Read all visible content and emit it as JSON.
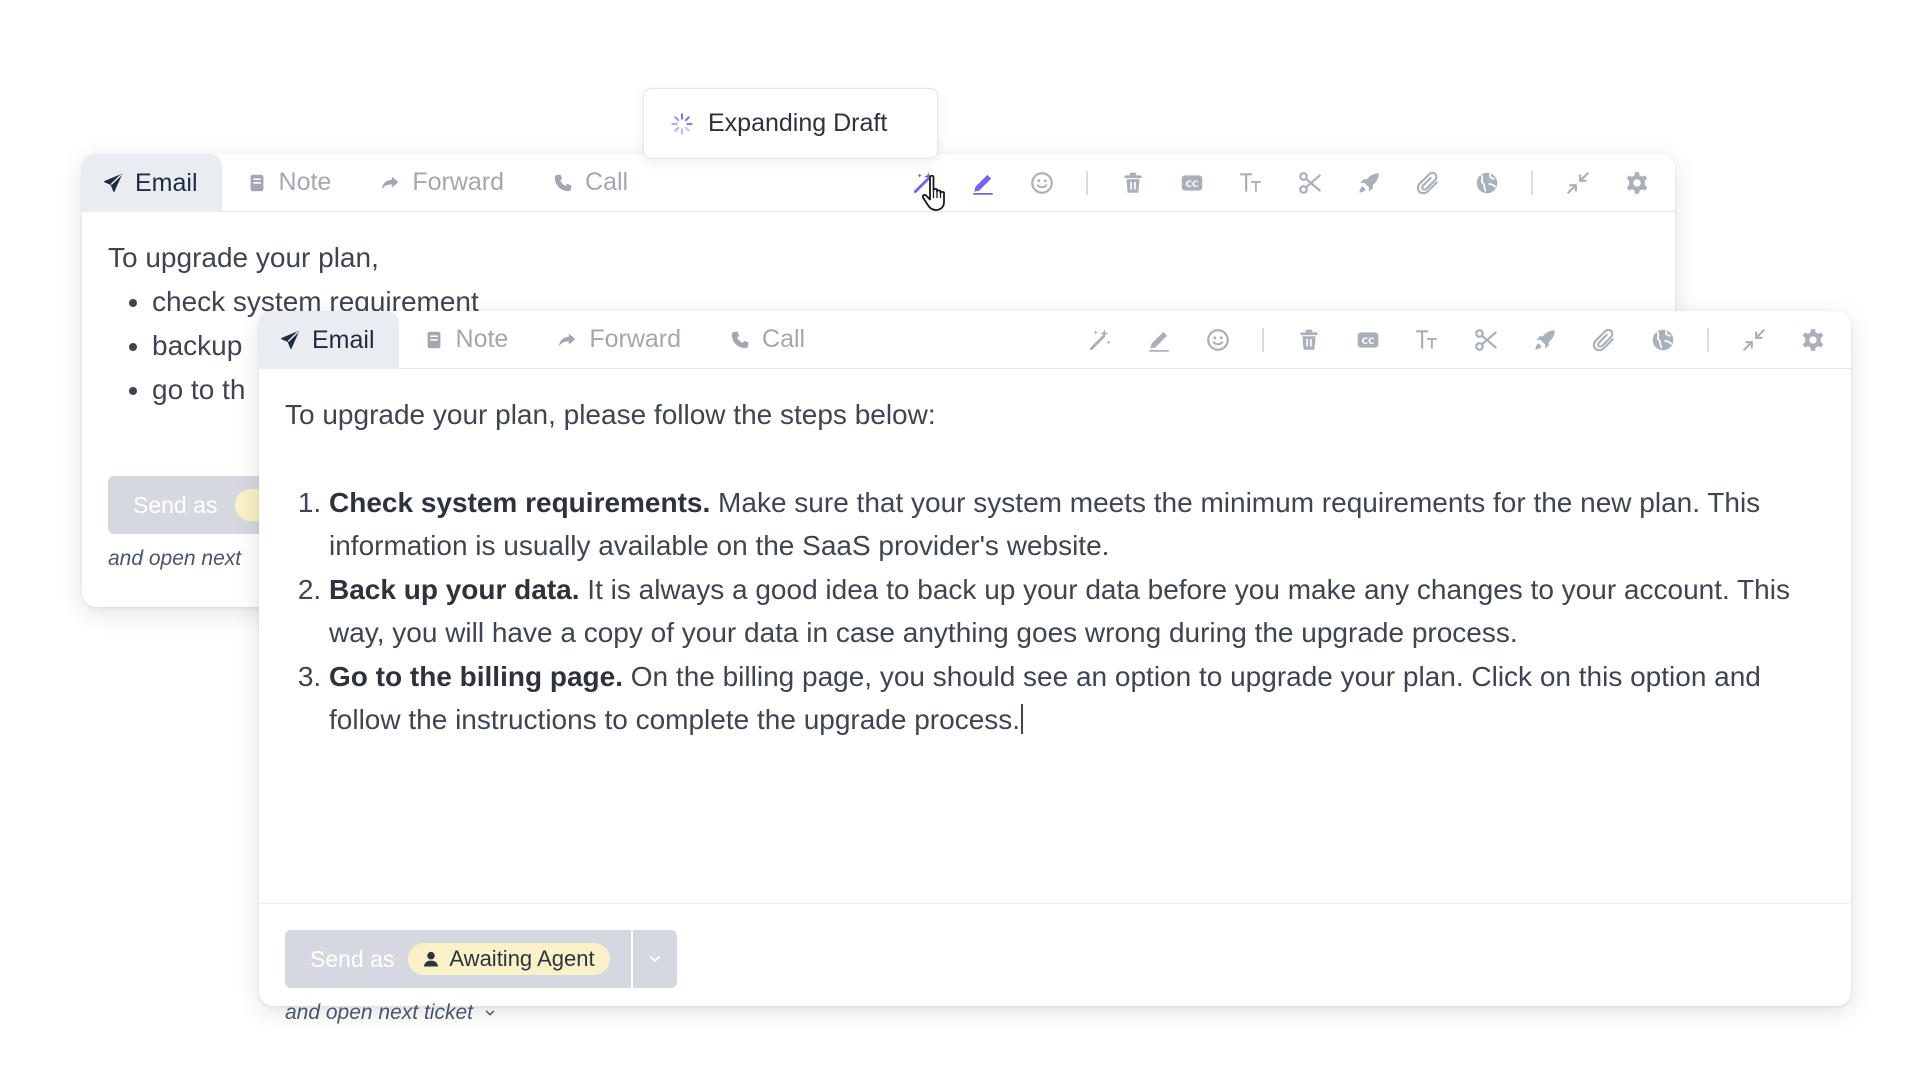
{
  "tooltip": {
    "label": "Expanding Draft",
    "icon": "spinner-icon"
  },
  "tabs": [
    {
      "label": "Email",
      "icon": "send-icon",
      "active": true
    },
    {
      "label": "Note",
      "icon": "note-icon"
    },
    {
      "label": "Forward",
      "icon": "forward-icon"
    },
    {
      "label": "Call",
      "icon": "phone-icon"
    }
  ],
  "toolbar_icons": [
    "magic-wand-icon",
    "pencil-icon",
    "emoji-icon",
    "trash-icon",
    "cc-icon",
    "text-size-icon",
    "scissors-icon",
    "rocket-icon",
    "attach-icon",
    "globe-icon",
    "collapse-icon",
    "settings-icon"
  ],
  "colors": {
    "accent": "#7a5ff0",
    "send_bg": "#d5d9df",
    "status_pill": "#fbf1c8",
    "active_tab": "#e9ecf1"
  },
  "back_draft": {
    "intro": "To upgrade your plan,",
    "bullets": [
      "check system requirement",
      "backup",
      "go to th"
    ],
    "send_label": "Send as",
    "next_label": "and open next"
  },
  "front_draft": {
    "intro": "To upgrade your plan, please follow the steps below:",
    "steps": [
      {
        "title": "Check system requirements.",
        "text": " Make sure that your system meets the minimum requirements for the new plan. This information is usually available on the SaaS provider's website."
      },
      {
        "title": "Back up your data.",
        "text": " It is always a good idea to back up your data before you make any changes to your account. This way, you will have a copy of your data in case anything goes wrong during the upgrade process."
      },
      {
        "title": "Go to the billing page.",
        "text": " On the billing page, you should see an option to upgrade your plan. Click on this option and follow the instructions to complete the upgrade process."
      }
    ],
    "send_label": "Send as",
    "status": "Awaiting Agent",
    "next_label": "and open next ticket"
  }
}
